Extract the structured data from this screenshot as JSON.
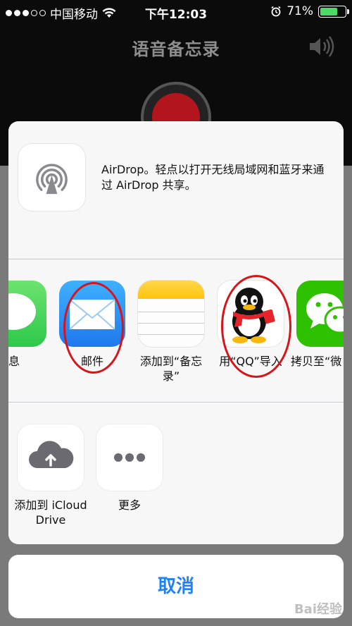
{
  "status_bar": {
    "carrier": "中国移动",
    "time": "下午12:03",
    "battery_percent": "71%",
    "battery_level": 0.71
  },
  "app": {
    "title": "语音备忘录"
  },
  "share_sheet": {
    "airdrop": {
      "icon": "airdrop-icon",
      "text": "AirDrop。轻点以打开无线局域网和蓝牙来通过 AirDrop 共享。"
    },
    "apps": [
      {
        "label": "信息",
        "icon": "messages-icon"
      },
      {
        "label": "邮件",
        "icon": "mail-icon"
      },
      {
        "label": "添加到“备忘录”",
        "icon": "notes-icon"
      },
      {
        "label": "用“QQ”导入",
        "icon": "qq-icon"
      },
      {
        "label": "拷贝至“微",
        "icon": "wechat-icon"
      }
    ],
    "actions": [
      {
        "label": "添加到 iCloud Drive",
        "icon": "icloud-drive-icon"
      },
      {
        "label": "更多",
        "icon": "more-icon"
      }
    ],
    "cancel_label": "取消"
  },
  "colors": {
    "accent": "#1a82fb",
    "annotation": "#d8141b",
    "messages_green": "#4cd964",
    "mail_blue": "#1e88f0",
    "notes_yellow": "#ffcc1a",
    "wechat_green": "#2dc100"
  },
  "watermark": "Bai经验"
}
